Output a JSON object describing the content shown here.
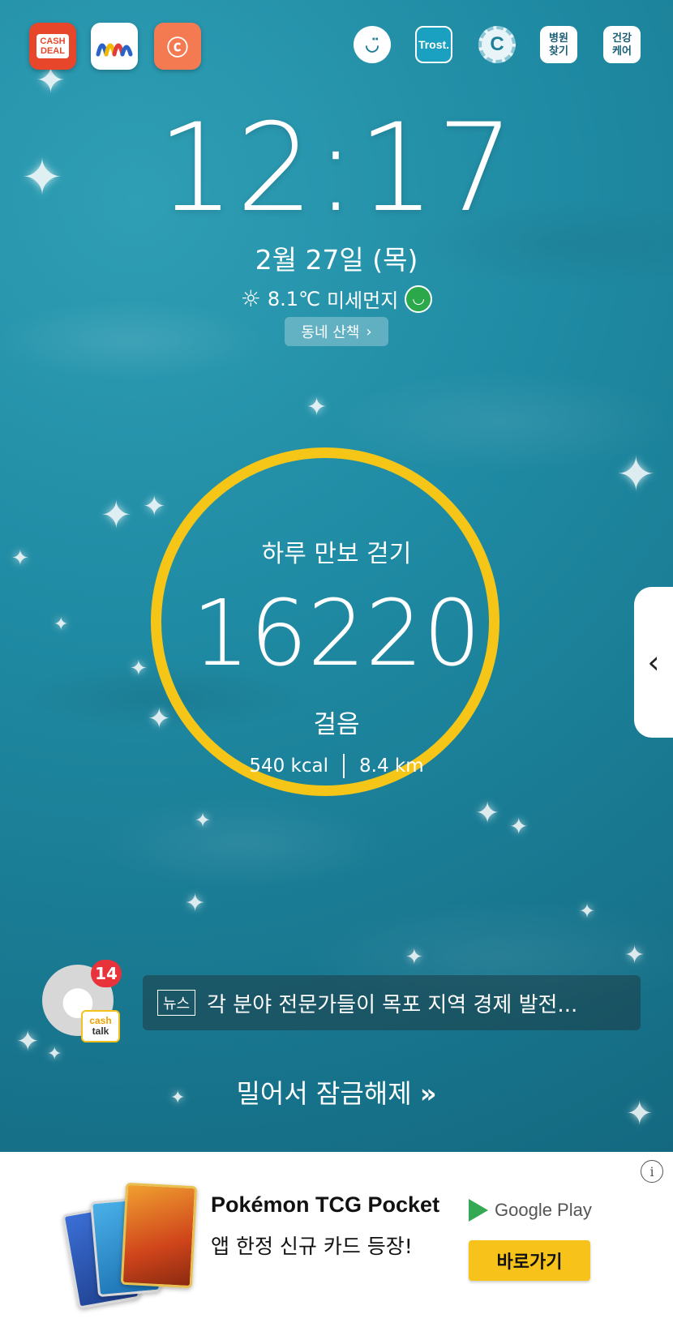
{
  "shortcuts": {
    "cashdeal_label_1": "CASH",
    "cashdeal_label_2": "DEAL",
    "trost_label": "Trost.",
    "c_label": "C",
    "hospital_line1": "병원",
    "hospital_line2": "찾기",
    "care_line1": "건강",
    "care_line2": "케어"
  },
  "lockscreen": {
    "time": "12:17",
    "date": "2월 27일 (목)",
    "temperature": "8.1℃",
    "dust_label": "미세먼지",
    "walk_chip": "동네 산책"
  },
  "steps": {
    "title": "하루 만보 걷기",
    "count": "16220",
    "unit": "걸음",
    "kcal": "540 kcal",
    "distance": "8.4 km",
    "ring_color": "#f5c518"
  },
  "cashtalk": {
    "badge_count": "14",
    "label_1": "cash",
    "label_2": "talk"
  },
  "news": {
    "tag": "뉴스",
    "headline": "각 분야 전문가들이 목포 지역 경제 발전..."
  },
  "unlock": {
    "label": "밀어서 잠금해제",
    "arrows": "»"
  },
  "ad": {
    "title": "Pokémon TCG Pocket",
    "subtitle": "앱 한정 신규 카드 등장!",
    "store": "Google Play",
    "button": "바로가기",
    "button_color": "#f7c21a"
  }
}
